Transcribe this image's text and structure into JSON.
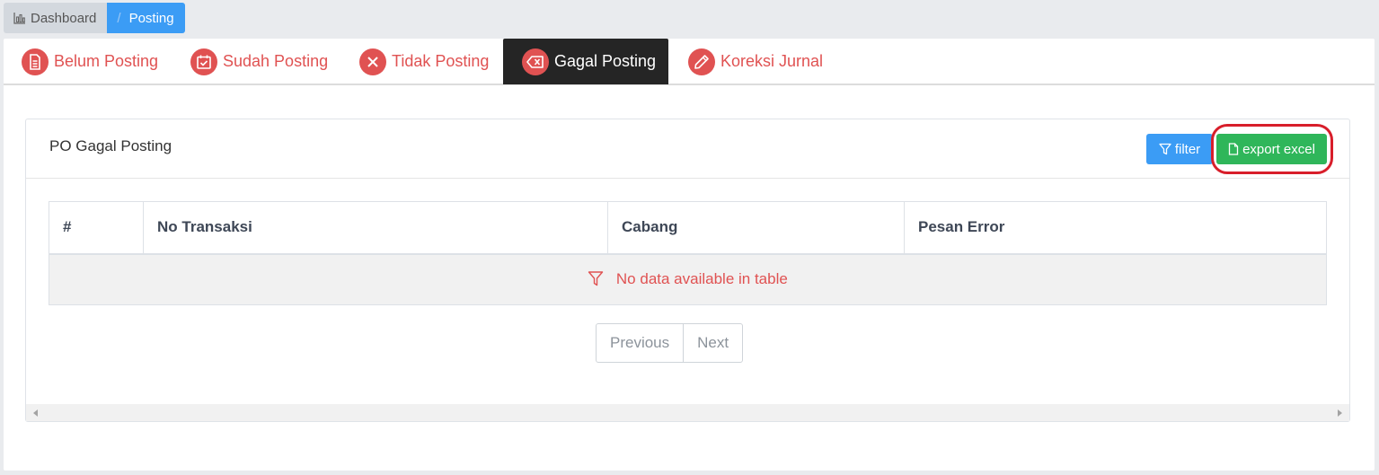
{
  "breadcrumb": {
    "items": [
      {
        "label": "Dashboard",
        "icon": "bar-chart-icon"
      },
      {
        "label": "Posting",
        "separator": "/"
      }
    ]
  },
  "tabs": [
    {
      "label": "Belum Posting",
      "icon": "document-icon",
      "active": false
    },
    {
      "label": "Sudah Posting",
      "icon": "calendar-check-icon",
      "active": false
    },
    {
      "label": "Tidak Posting",
      "icon": "x-icon",
      "active": false
    },
    {
      "label": "Gagal Posting",
      "icon": "backspace-icon",
      "active": true
    },
    {
      "label": "Koreksi Jurnal",
      "icon": "pen-icon",
      "active": false
    }
  ],
  "card": {
    "title": "PO Gagal Posting",
    "filter_label": "filter",
    "export_label": "export excel"
  },
  "table": {
    "columns": [
      "#",
      "No Transaksi",
      "Cabang",
      "Pesan Error"
    ],
    "empty_message": "No data available in table"
  },
  "pagination": {
    "previous": "Previous",
    "next": "Next"
  },
  "colors": {
    "accent_red": "#e05252",
    "primary_blue": "#3b9cf5",
    "success_green": "#2fb65a",
    "active_tab_bg": "#252525",
    "highlight_ring": "#d81e2a"
  }
}
